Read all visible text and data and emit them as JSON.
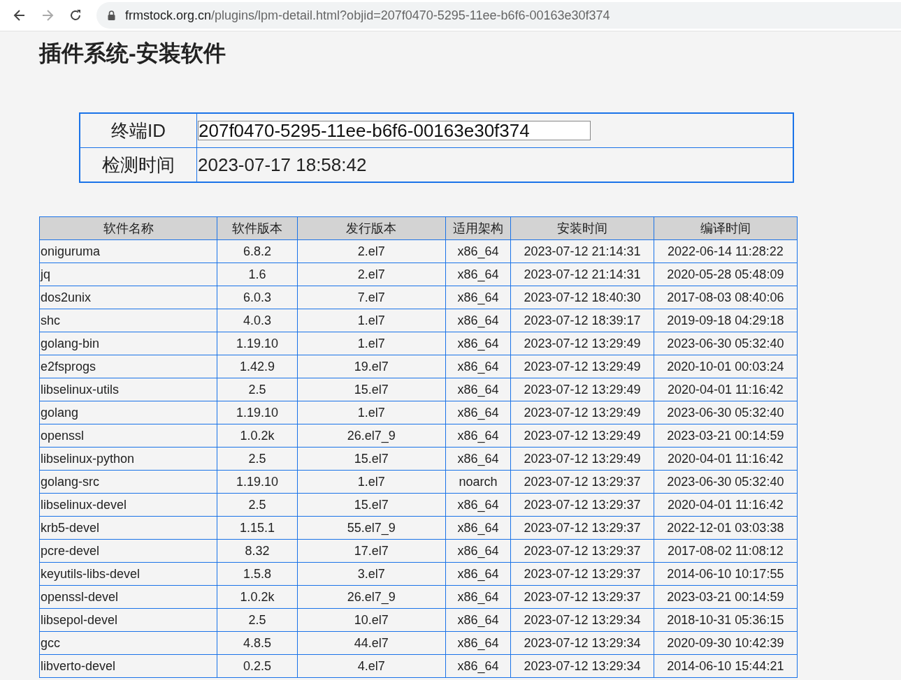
{
  "browser": {
    "url_host": "frmstock.org.cn",
    "url_path": "/plugins/lpm-detail.html?objid=207f0470-5295-11ee-b6f6-00163e30f374"
  },
  "page_title": "插件系统-安装软件",
  "info": {
    "terminal_label": "终端ID",
    "terminal_value": "207f0470-5295-11ee-b6f6-00163e30f374",
    "time_label": "检测时间",
    "time_value": "2023-07-17 18:58:42"
  },
  "table": {
    "columns": [
      "软件名称",
      "软件版本",
      "发行版本",
      "适用架构",
      "安装时间",
      "编译时间"
    ],
    "rows": [
      [
        "oniguruma",
        "6.8.2",
        "2.el7",
        "x86_64",
        "2023-07-12 21:14:31",
        "2022-06-14 11:28:22"
      ],
      [
        "jq",
        "1.6",
        "2.el7",
        "x86_64",
        "2023-07-12 21:14:31",
        "2020-05-28 05:48:09"
      ],
      [
        "dos2unix",
        "6.0.3",
        "7.el7",
        "x86_64",
        "2023-07-12 18:40:30",
        "2017-08-03 08:40:06"
      ],
      [
        "shc",
        "4.0.3",
        "1.el7",
        "x86_64",
        "2023-07-12 18:39:17",
        "2019-09-18 04:29:18"
      ],
      [
        "golang-bin",
        "1.19.10",
        "1.el7",
        "x86_64",
        "2023-07-12 13:29:49",
        "2023-06-30 05:32:40"
      ],
      [
        "e2fsprogs",
        "1.42.9",
        "19.el7",
        "x86_64",
        "2023-07-12 13:29:49",
        "2020-10-01 00:03:24"
      ],
      [
        "libselinux-utils",
        "2.5",
        "15.el7",
        "x86_64",
        "2023-07-12 13:29:49",
        "2020-04-01 11:16:42"
      ],
      [
        "golang",
        "1.19.10",
        "1.el7",
        "x86_64",
        "2023-07-12 13:29:49",
        "2023-06-30 05:32:40"
      ],
      [
        "openssl",
        "1.0.2k",
        "26.el7_9",
        "x86_64",
        "2023-07-12 13:29:49",
        "2023-03-21 00:14:59"
      ],
      [
        "libselinux-python",
        "2.5",
        "15.el7",
        "x86_64",
        "2023-07-12 13:29:49",
        "2020-04-01 11:16:42"
      ],
      [
        "golang-src",
        "1.19.10",
        "1.el7",
        "noarch",
        "2023-07-12 13:29:37",
        "2023-06-30 05:32:40"
      ],
      [
        "libselinux-devel",
        "2.5",
        "15.el7",
        "x86_64",
        "2023-07-12 13:29:37",
        "2020-04-01 11:16:42"
      ],
      [
        "krb5-devel",
        "1.15.1",
        "55.el7_9",
        "x86_64",
        "2023-07-12 13:29:37",
        "2022-12-01 03:03:38"
      ],
      [
        "pcre-devel",
        "8.32",
        "17.el7",
        "x86_64",
        "2023-07-12 13:29:37",
        "2017-08-02 11:08:12"
      ],
      [
        "keyutils-libs-devel",
        "1.5.8",
        "3.el7",
        "x86_64",
        "2023-07-12 13:29:37",
        "2014-06-10 10:17:55"
      ],
      [
        "openssl-devel",
        "1.0.2k",
        "26.el7_9",
        "x86_64",
        "2023-07-12 13:29:37",
        "2023-03-21 00:14:59"
      ],
      [
        "libsepol-devel",
        "2.5",
        "10.el7",
        "x86_64",
        "2023-07-12 13:29:34",
        "2018-10-31 05:36:15"
      ],
      [
        "gcc",
        "4.8.5",
        "44.el7",
        "x86_64",
        "2023-07-12 13:29:34",
        "2020-09-30 10:42:39"
      ],
      [
        "libverto-devel",
        "0.2.5",
        "4.el7",
        "x86_64",
        "2023-07-12 13:29:34",
        "2014-06-10 15:44:21"
      ]
    ]
  }
}
